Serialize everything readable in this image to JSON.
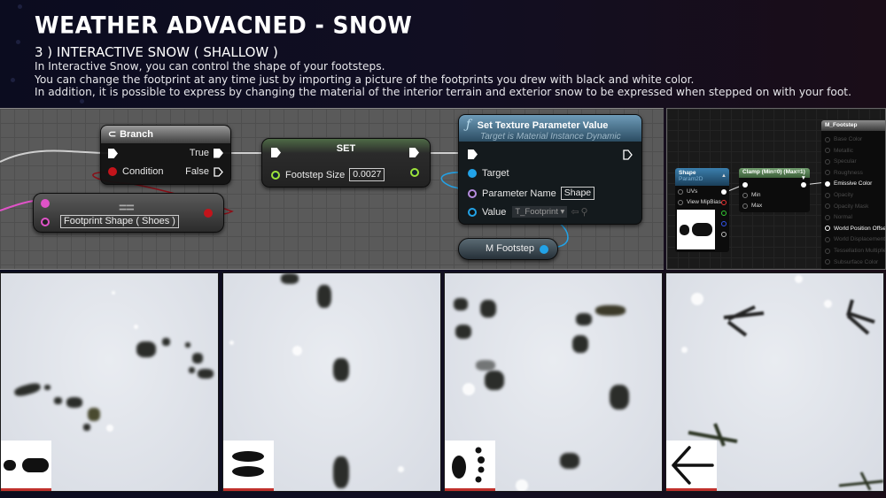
{
  "header": {
    "title": "WEATHER ADVACNED - SNOW",
    "subtitle": "3 ) INTERACTIVE SNOW ( SHALLOW )",
    "description": [
      "In Interactive Snow, you can control the shape of your footsteps.",
      "You can change the footprint at any time just by importing a picture of the footprints you drew with black and white color.",
      "In addition, it is possible to express by changing the material of the interior terrain and exterior snow to be expressed when stepped on with your foot."
    ]
  },
  "blueprint": {
    "branch_node": {
      "title": "Branch",
      "icon": "branch-icon",
      "condition_label": "Condition",
      "true_label": "True",
      "false_label": "False"
    },
    "equals_node": {
      "operator": "==",
      "value": "Footprint Shape ( Shoes )"
    },
    "set_node": {
      "title": "SET",
      "variable_label": "Footstep Size",
      "variable_value": "0.0027"
    },
    "texture_node": {
      "icon": "function-icon",
      "title": "Set Texture Parameter Value",
      "subtitle": "Target is Material Instance Dynamic",
      "target_label": "Target",
      "param_name_label": "Parameter Name",
      "param_name_value": "Shape",
      "value_label": "Value",
      "value_selected": "T_Footprint"
    },
    "variable_node": {
      "label": "M Footstep"
    },
    "colors": {
      "exec": "#ffffff",
      "bool": "#c3141b",
      "struct": "#e053c8",
      "float": "#9ee33a",
      "object": "#22a3e8",
      "name": "#b68de0"
    }
  },
  "material": {
    "param_node": {
      "title": "Shape",
      "subtitle": "Param2D",
      "pins": [
        "UVs",
        "View MipBias"
      ]
    },
    "clamp_node": {
      "title": "Clamp (Min=0) (Max=1)",
      "pins": [
        "Min",
        "Max"
      ]
    },
    "output_node": {
      "title": "M_Footstep",
      "pins": [
        {
          "label": "Base Color",
          "active": false
        },
        {
          "label": "Metallic",
          "active": false
        },
        {
          "label": "Specular",
          "active": false
        },
        {
          "label": "Roughness",
          "active": false
        },
        {
          "label": "Emissive Color",
          "active": true
        },
        {
          "label": "Opacity",
          "active": false
        },
        {
          "label": "Opacity Mask",
          "active": false
        },
        {
          "label": "Normal",
          "active": false
        },
        {
          "label": "World Position Offset",
          "active": true
        },
        {
          "label": "World Displacement",
          "active": false
        },
        {
          "label": "Tessellation Multiplier",
          "active": false
        },
        {
          "label": "Subsurface Color",
          "active": false
        }
      ]
    }
  },
  "examples": [
    {
      "name": "shoes",
      "shape_icon": "shoe-print-icon"
    },
    {
      "name": "hooves",
      "shape_icon": "hoof-print-icon"
    },
    {
      "name": "paws",
      "shape_icon": "paw-print-icon"
    },
    {
      "name": "bird",
      "shape_icon": "bird-print-icon"
    }
  ]
}
